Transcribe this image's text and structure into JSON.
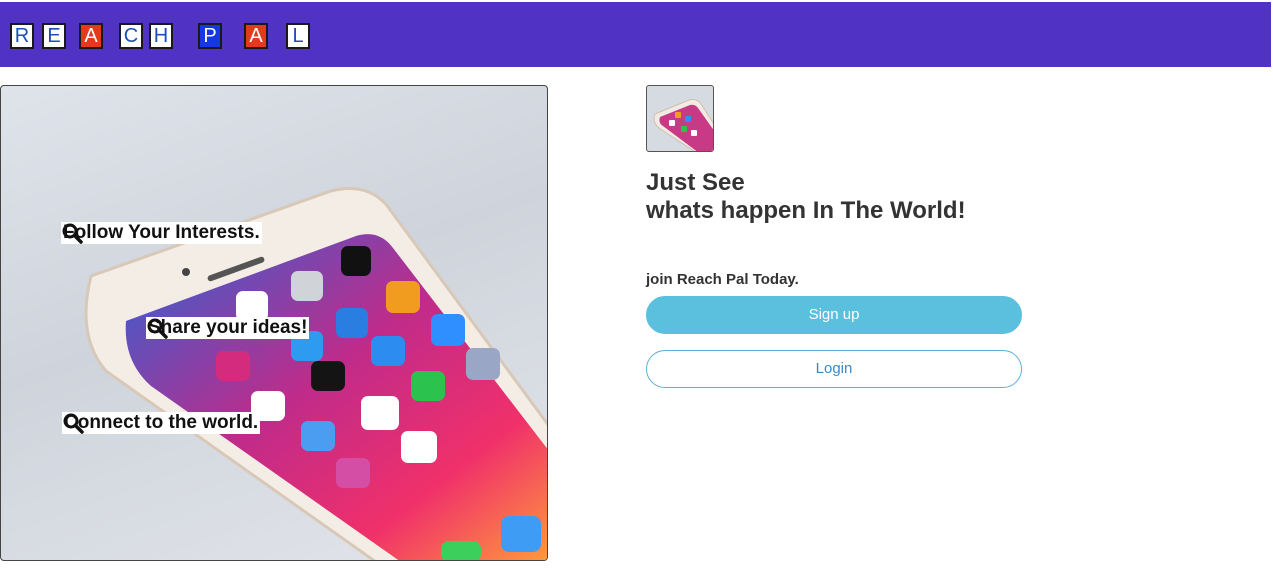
{
  "header": {
    "logo_letters": [
      {
        "char": "R",
        "style": "white"
      },
      {
        "char": "E",
        "style": "white"
      },
      {
        "char": "A",
        "style": "red"
      },
      {
        "char": "C",
        "style": "white"
      },
      {
        "char": "H",
        "style": "white"
      },
      {
        "char": "P",
        "style": "blue"
      },
      {
        "char": "A",
        "style": "red"
      },
      {
        "char": "L",
        "style": "white"
      }
    ],
    "bar_color": "#5033c4"
  },
  "hero": {
    "features": [
      {
        "icon": "search-icon",
        "text": "Follow Your Interests."
      },
      {
        "icon": "search-icon",
        "text": "Share your ideas!"
      },
      {
        "icon": "search-icon",
        "text": "Connect to the world."
      }
    ]
  },
  "main": {
    "headline_line1": "Just See",
    "headline_line2": "whats happen In The World!",
    "join_text": "join Reach Pal Today.",
    "signup_label": "Sign up",
    "login_label": "Login"
  },
  "colors": {
    "signup_bg": "#5bc0de",
    "login_text": "#3a8ac9"
  }
}
